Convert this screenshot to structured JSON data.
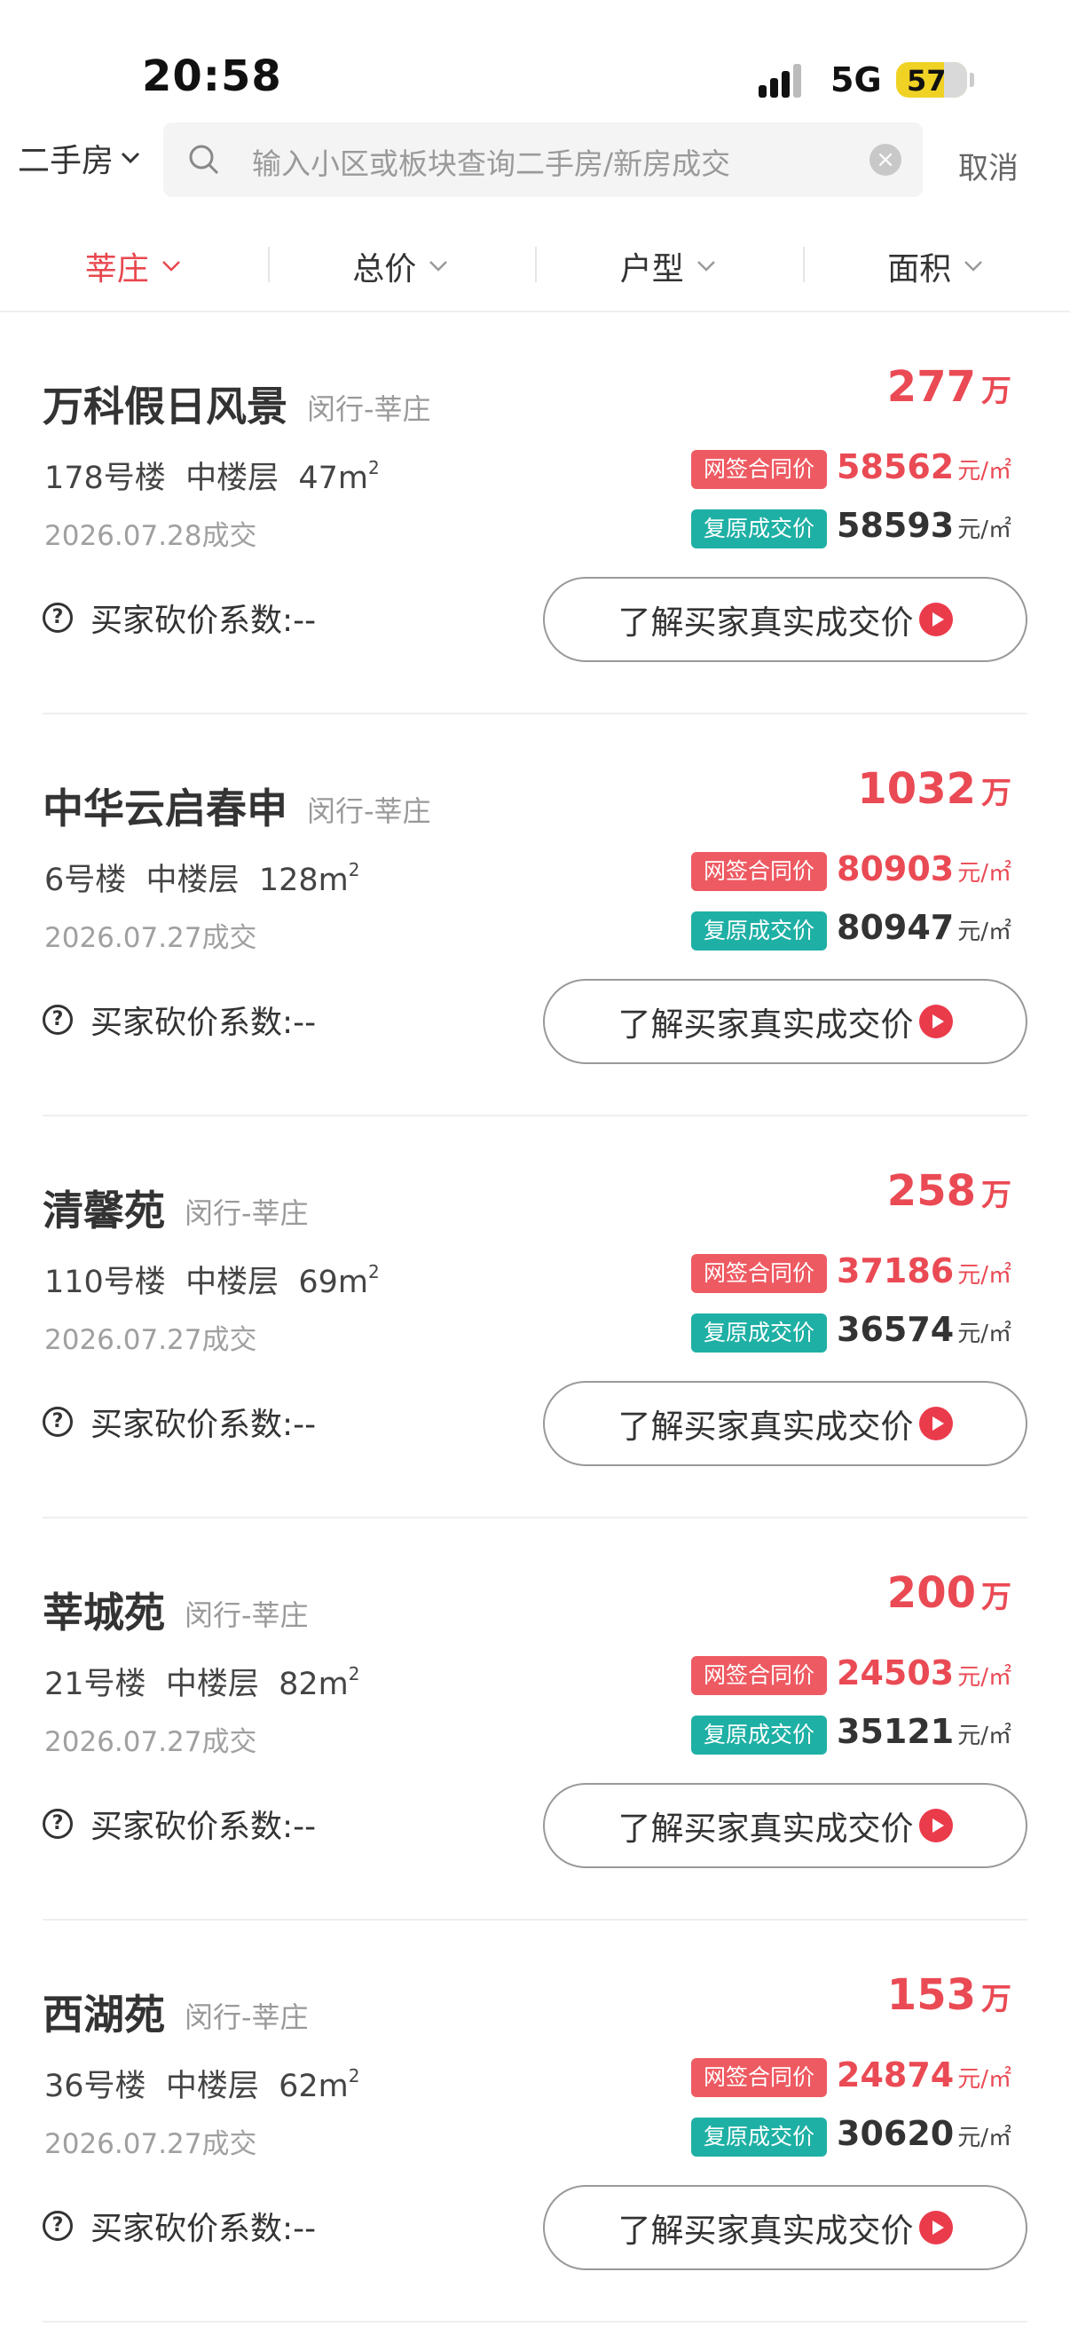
{
  "status_bar": {
    "time": "20:58",
    "network": "5G",
    "battery": "57"
  },
  "search": {
    "city_label": "二手房",
    "placeholder": "输入小区或板块查询二手房/新房成交",
    "cancel_label": "取消"
  },
  "filters": [
    {
      "label": "莘庄",
      "active": true
    },
    {
      "label": "总价",
      "active": false
    },
    {
      "label": "户型",
      "active": false
    },
    {
      "label": "面积",
      "active": false
    }
  ],
  "labels": {
    "total_unit": "万",
    "sign_tag": "网签合同价",
    "restore_tag": "复原成交价",
    "price_unit": "元/㎡",
    "bargain": "买家砍价系数:--",
    "cta": "了解买家真实成交价"
  },
  "colors": {
    "accent_red": "#ea4a54",
    "teal": "#1fb0a5"
  },
  "listings": [
    {
      "name": "万科假日风景",
      "district": "闵行-莘庄",
      "total": "277",
      "building": "178号楼",
      "floor": "中楼层",
      "area": "47",
      "date": "2026.07.28成交",
      "sign_price": "58562",
      "restore_price": "58593"
    },
    {
      "name": "中华云启春申",
      "district": "闵行-莘庄",
      "total": "1032",
      "building": "6号楼",
      "floor": "中楼层",
      "area": "128",
      "date": "2026.07.27成交",
      "sign_price": "80903",
      "restore_price": "80947"
    },
    {
      "name": "清馨苑",
      "district": "闵行-莘庄",
      "total": "258",
      "building": "110号楼",
      "floor": "中楼层",
      "area": "69",
      "date": "2026.07.27成交",
      "sign_price": "37186",
      "restore_price": "36574"
    },
    {
      "name": "莘城苑",
      "district": "闵行-莘庄",
      "total": "200",
      "building": "21号楼",
      "floor": "中楼层",
      "area": "82",
      "date": "2026.07.27成交",
      "sign_price": "24503",
      "restore_price": "35121"
    },
    {
      "name": "西湖苑",
      "district": "闵行-莘庄",
      "total": "153",
      "building": "36号楼",
      "floor": "中楼层",
      "area": "62",
      "date": "2026.07.27成交",
      "sign_price": "24874",
      "restore_price": "30620"
    }
  ]
}
